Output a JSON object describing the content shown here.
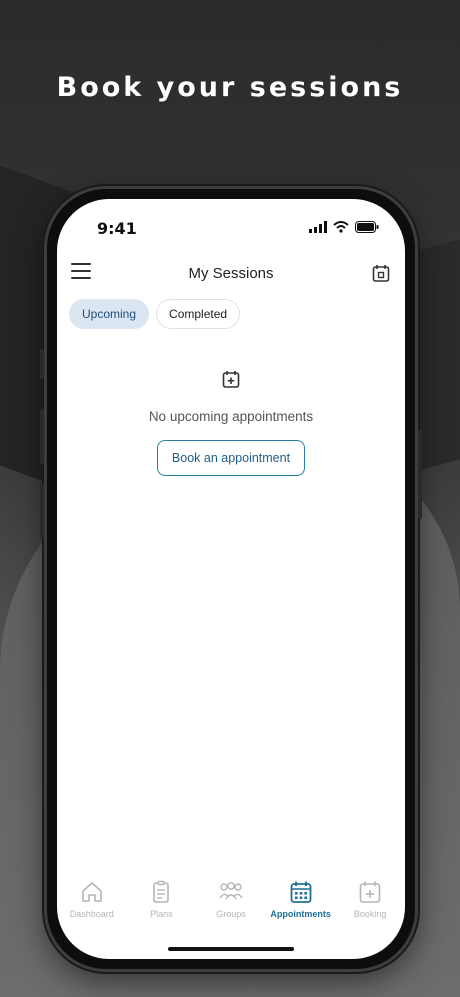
{
  "headline": "Book your sessions",
  "status": {
    "time": "9:41"
  },
  "header": {
    "title": "My Sessions"
  },
  "tabs": [
    {
      "label": "Upcoming",
      "active": true
    },
    {
      "label": "Completed",
      "active": false
    }
  ],
  "empty_state": {
    "message": "No upcoming appointments",
    "button_label": "Book an appointment"
  },
  "nav": [
    {
      "label": "Dashboard",
      "icon": "home-icon"
    },
    {
      "label": "Plans",
      "icon": "clipboard-icon"
    },
    {
      "label": "Groups",
      "icon": "group-icon"
    },
    {
      "label": "Appointments",
      "icon": "calendar-grid-icon",
      "active": true
    },
    {
      "label": "Booking",
      "icon": "calendar-plus-icon"
    }
  ],
  "colors": {
    "accent": "#1f6f96",
    "tab_active_bg": "#dbe6f2",
    "inactive_nav": "#b5b5b5"
  }
}
